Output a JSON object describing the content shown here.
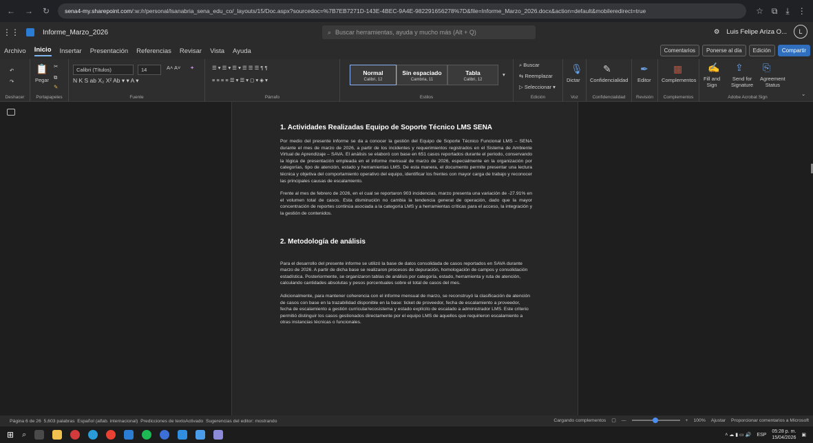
{
  "browser": {
    "url_prefix": "sena4-my.sharepoint.com",
    "url_rest": "/:w:/r/personal/lsanabria_sena_edu_co/_layouts/15/Doc.aspx?sourcedoc=%7B7EB7271D-143E-4BEC-9A4E-982291656278%7D&file=Informe_Marzo_2026.docx&action=default&mobileredirect=true"
  },
  "app": {
    "doc_name": "Informe_Marzo_2026",
    "search_placeholder": "Buscar herramientas, ayuda y mucho más (Alt + Q)",
    "user_name": "Luis Felipe Ariza O...",
    "avatar_initial": "L"
  },
  "menu": {
    "tabs": [
      "Archivo",
      "Inicio",
      "Insertar",
      "Presentación",
      "Referencias",
      "Revisar",
      "Vista",
      "Ayuda"
    ],
    "comments": "Comentarios",
    "catch_up": "Ponerse al día",
    "editing": "Edición",
    "share": "Compartir"
  },
  "ribbon": {
    "undo_label": "Deshacer",
    "clipboard_label": "Portapapeles",
    "paste": "Pegar",
    "font_name": "Calibri (Títulos)",
    "font_size": "14",
    "font_label": "Fuente",
    "paragraph_label": "Párrafo",
    "styles": [
      {
        "name": "Normal",
        "font": "Calibri, 12"
      },
      {
        "name": "Sin espaciado",
        "font": "Cambria, 11"
      },
      {
        "name": "Tabla",
        "font": "Calibri, 12"
      }
    ],
    "styles_label": "Estilos",
    "find": "Buscar",
    "replace": "Reemplazar",
    "select": "Seleccionar",
    "editing_label": "Edición",
    "dictate": "Dictar",
    "voice_label": "Voz",
    "sensitivity": "Confidencialidad",
    "sensitivity_label": "Confidencialidad",
    "editor": "Editor",
    "review_label": "Revisión",
    "addins": "Complementos",
    "addins_label": "Complementos",
    "adobe1": "Fill and",
    "adobe1b": "Sign",
    "adobe2": "Send for",
    "adobe2b": "Signature",
    "adobe3": "Agreement",
    "adobe3b": "Status",
    "adobe_label": "Adobe Acrobat Sign"
  },
  "doc": {
    "h1": "1. Actividades Realizadas Equipo de Soporte Técnico LMS SENA",
    "p1": "Por medio del presente informe se da a conocer la gestión del Equipo de Soporte Técnico Funcional LMS – SENA durante el mes de marzo de 2026, a partir de los incidentes y requerimientos registrados en el Sistema de Ambiente Virtual de Aprendizaje – SAVA. El análisis se elaboró con base en 651 casos reportados durante el periodo, conservando la lógica de presentación empleada en el informe mensual de marzo de 2026, especialmente en la organización por categorías, tipo de atención, estado y herramientas LMS. De esta manera, el documento permite presentar una lectura técnica y objetiva del comportamiento operativo del equipo, identificar los frentes con mayor carga de trabajo y reconocer las principales causas de escalamiento.",
    "p2": "Frente al mes de febrero de 2026, en el cual se reportaron 903 incidencias, marzo presenta una variación de -27.91% en el volumen total de casos. Esta disminución no cambia la tendencia general de operación, dado que la mayor concentración de reportes continúa asociada a la categoría LMS y a herramientas críticas para el acceso, la integración y la gestión de contenidos.",
    "h2": "2. Metodología de análisis",
    "p3": "Para el desarrollo del presente informe se utilizó la base de datos consolidada de casos reportados en SAVA durante marzo de 2026. A partir de dicha base se realizaron procesos de depuración, homologación de campos y consolidación estadística. Posteriormente, se organizaron tablas de análisis por categoría, estado, herramienta y ruta de atención, calculando cantidades absolutas y pesos porcentuales sobre el total de casos del mes.",
    "p4": "Adicionalmente, para mantener coherencia con el informe mensual de marzo, se reconstruyó la clasificación de atención de casos con base en la trazabilidad disponible en la base: ticket de proveedor, fecha de escalamiento a proveedor, fecha de escalamiento a gestión curricular/ecosistema y estado explícito de escalado a administrador LMS. Este criterio permitió distinguir los casos gestionados directamente por el equipo LMS de aquellos que requirieron escalamiento a otras instancias técnicas o funcionales."
  },
  "status": {
    "page": "Página 6 de 26",
    "words": "5,603 palabras",
    "lang": "Español (alfab. internacional)",
    "predictions": "Predicciones de textoActivado",
    "suggestions": "Sugerencias del editor: mostrando",
    "loading": "Cargando complementos",
    "zoom": "100%",
    "fit": "Ajustar",
    "feedback": "Proporcionar comentarios a Microsoft"
  },
  "taskbar": {
    "lang": "ESP",
    "time": "05:28 p. m.",
    "date": "15/04/2026"
  }
}
